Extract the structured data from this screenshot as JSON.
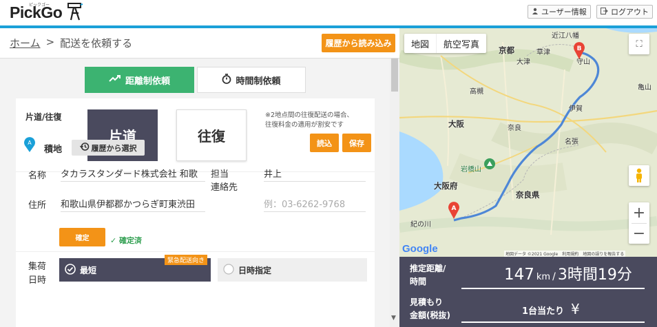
{
  "header": {
    "logo_text": "PickGo",
    "logo_kana": "ピックゴー",
    "user_info_label": "ユーザー情報",
    "logout_label": "ログアウト",
    "accent": "#1aa0d8"
  },
  "breadcrumb": {
    "home": "ホーム",
    "separator": ">",
    "current": "配送を依頼する"
  },
  "load_history_button": "履歴から読み込み",
  "tabs": {
    "distance": "距離制依頼",
    "time": "時間制依頼"
  },
  "trip": {
    "label": "片道/往復",
    "oneway": "片道",
    "roundtrip": "往復",
    "note_line1": "※2地点間の往復配送の場合、",
    "note_line2": "往復料金の適用が割安です"
  },
  "loading": {
    "pin_letter": "A",
    "title": "積地",
    "select_history": "履歴から選択",
    "read_button": "読込",
    "save_button": "保存",
    "name_label": "名称",
    "name_value": "タカラスタンダード株式会社 和歌",
    "contact_label_1": "担当",
    "contact_label_2": "連絡先",
    "contact_value": "井上",
    "address_label": "住所",
    "address_value": "和歌山県伊都郡かつらぎ町東渋田",
    "phone_placeholder": "例：03-6262-9768",
    "confirm_button": "確定",
    "confirmed_text": "確定済"
  },
  "pickup": {
    "label_1": "集荷",
    "label_2": "日時",
    "fastest": "最短",
    "urgent_badge": "緊急配送向き",
    "specify": "日時指定"
  },
  "map": {
    "tab_map": "地図",
    "tab_satellite": "航空写真",
    "labels": [
      "近江八幡",
      "京都",
      "草津",
      "大津",
      "守山",
      "高槻",
      "亀山",
      "伊賀",
      "大阪",
      "奈良",
      "名張",
      "岩橋山",
      "大阪府",
      "奈良県",
      "紀の川"
    ],
    "pin_a": "A",
    "pin_b": "B",
    "google": "Google",
    "attribution": "地図データ ©2021 Google　利用規約　地図の誤りを報告する",
    "zoom_in": "+",
    "zoom_out": "−"
  },
  "estimate": {
    "distance_label_1": "推定距離/",
    "distance_label_2": "時間",
    "distance_value": "147",
    "distance_unit": "km",
    "slash": "/",
    "time_value": "3時間19分",
    "price_label_1": "見積もり",
    "price_label_2": "金額(税抜)",
    "per_vehicle": "1台当たり",
    "yen": "¥"
  }
}
